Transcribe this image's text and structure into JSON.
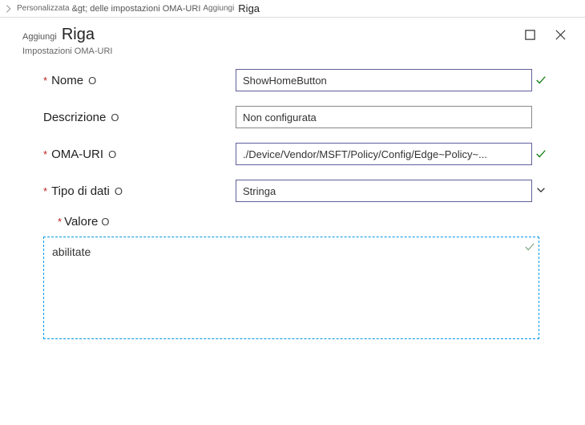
{
  "breadcrumb": {
    "item1": "Personalizzata",
    "item2": "&gt; delle impostazioni OMA-URI",
    "item3": "Aggiungi",
    "item4": "Riga"
  },
  "header": {
    "pre": "Aggiungi",
    "title": "Riga",
    "subtitle": "Impostazioni OMA-URI"
  },
  "labels": {
    "name": "Nome",
    "description": "Descrizione",
    "omauri": "OMA-URI",
    "datatype": "Tipo di dati",
    "value": "Valore",
    "info": "O"
  },
  "fields": {
    "name": "ShowHomeButton",
    "description": "Non configurata",
    "omauri": "./Device/Vendor/MSFT/Policy/Config/Edge~Policy~...",
    "datatype": "Stringa",
    "value": "abilitate"
  }
}
